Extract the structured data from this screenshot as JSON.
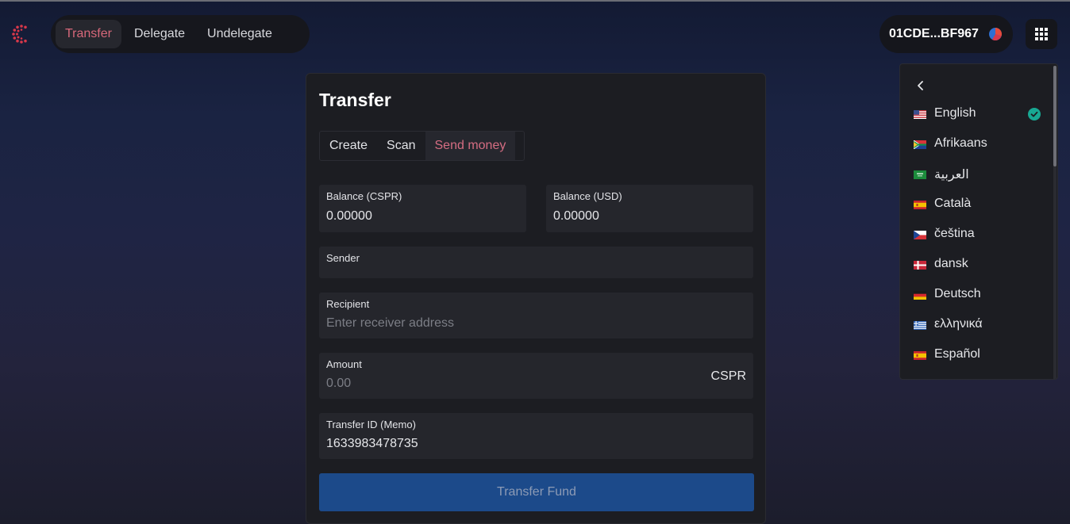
{
  "header": {
    "nav": [
      {
        "label": "Transfer",
        "active": true
      },
      {
        "label": "Delegate",
        "active": false
      },
      {
        "label": "Undelegate",
        "active": false
      }
    ],
    "account_label": "01CDE...BF967",
    "logo_icon": "casper-logo-icon",
    "apps_icon": "grid-apps-icon"
  },
  "card": {
    "title": "Transfer",
    "tabs": [
      {
        "label": "Create",
        "active": false
      },
      {
        "label": "Scan",
        "active": false
      },
      {
        "label": "Send money",
        "active": true
      }
    ],
    "balance_cspr": {
      "label": "Balance (CSPR)",
      "value": "0.00000"
    },
    "balance_usd": {
      "label": "Balance (USD)",
      "value": "0.00000"
    },
    "sender": {
      "label": "Sender",
      "value": ""
    },
    "recipient": {
      "label": "Recipient",
      "placeholder": "Enter receiver address",
      "value": ""
    },
    "amount": {
      "label": "Amount",
      "placeholder": "0.00",
      "unit": "CSPR"
    },
    "memo": {
      "label": "Transfer ID (Memo)",
      "value": "1633983478735"
    },
    "submit_label": "Transfer Fund"
  },
  "language_menu": {
    "back_icon": "chevron-left-icon",
    "selected": "English",
    "items": [
      {
        "label": "English",
        "flag": "us-flag-icon"
      },
      {
        "label": "Afrikaans",
        "flag": "za-flag-icon"
      },
      {
        "label": "العربية",
        "flag": "sa-flag-icon"
      },
      {
        "label": "Català",
        "flag": "es-flag-icon"
      },
      {
        "label": "čeština",
        "flag": "cz-flag-icon"
      },
      {
        "label": "dansk",
        "flag": "dk-flag-icon"
      },
      {
        "label": "Deutsch",
        "flag": "de-flag-icon"
      },
      {
        "label": "ελληνικά",
        "flag": "gr-flag-icon"
      },
      {
        "label": "Español",
        "flag": "es-flag-icon"
      }
    ]
  },
  "colors": {
    "accent": "#d7687a",
    "button": "#1c4a8a",
    "check": "#18a893"
  }
}
